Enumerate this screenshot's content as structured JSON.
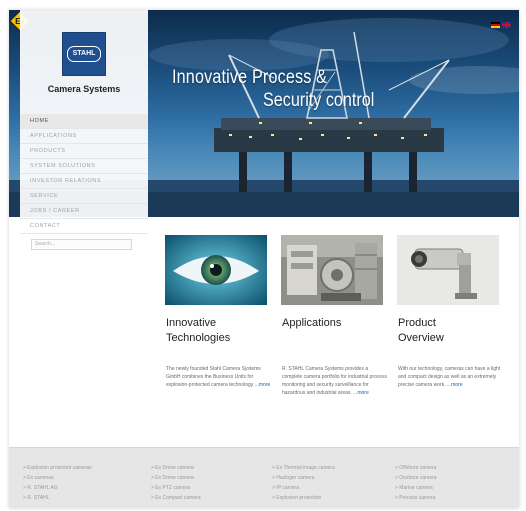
{
  "brand": {
    "logo_text": "STAHL",
    "subtitle": "Camera Systems"
  },
  "hero": {
    "line1": "Innovative Process &",
    "line2": "Security control"
  },
  "nav": [
    {
      "label": "HOME",
      "active": true
    },
    {
      "label": "APPLICATIONS",
      "active": false
    },
    {
      "label": "PRODUCTS",
      "active": false
    },
    {
      "label": "SYSTEM SOLUTIONS",
      "active": false
    },
    {
      "label": "INVESTOR RELATIONS",
      "active": false
    },
    {
      "label": "SERVICE",
      "active": false
    },
    {
      "label": "JOBS / CAREER",
      "active": false
    },
    {
      "label": "CONTACT",
      "active": false
    }
  ],
  "search": {
    "placeholder": "Search..."
  },
  "cards": [
    {
      "title_line1": "Innovative",
      "title_line2": "Technologies",
      "text": "The newly founded Stahl Camera Systems GmbH combines the Business Units for explosion-protected camera technology",
      "more": "more"
    },
    {
      "title_line1": "Applications",
      "title_line2": "",
      "text": "R. STAHL Camera Systems provides a complete camera portfolio for industrial process monitoring and security surveillance for hazardous and industrial areas.",
      "more": "more"
    },
    {
      "title_line1": "Product",
      "title_line2": "Overview",
      "text": "With our technology, cameras can have a light and compact design as well as an extremely precise camera work.",
      "more": "more"
    }
  ],
  "footer": {
    "columns": [
      [
        "> Explosion protected cameras",
        "> Ex cameras",
        "> R. STAHL AG",
        "> R. STAHL"
      ],
      [
        "> Ex Dome camera",
        "> Ex Dome camera",
        "> Ex PTZ camera",
        "> Ex Compact camera"
      ],
      [
        "> Ex Thermal image camera",
        "> Hazloger camera",
        "> IP camera",
        "> Explosion protection"
      ],
      [
        "> Offshore camera",
        "> Onshore camera",
        "> Marine camera",
        "> Process camera"
      ]
    ]
  },
  "colors": {
    "accent": "#1f4f8f",
    "link": "#1d5fb0",
    "ex_badge": "#f5c400"
  },
  "icons": {
    "ex_badge": "ex-hazard-icon",
    "flag_de": "german-flag-icon",
    "flag_en": "uk-flag-icon"
  }
}
